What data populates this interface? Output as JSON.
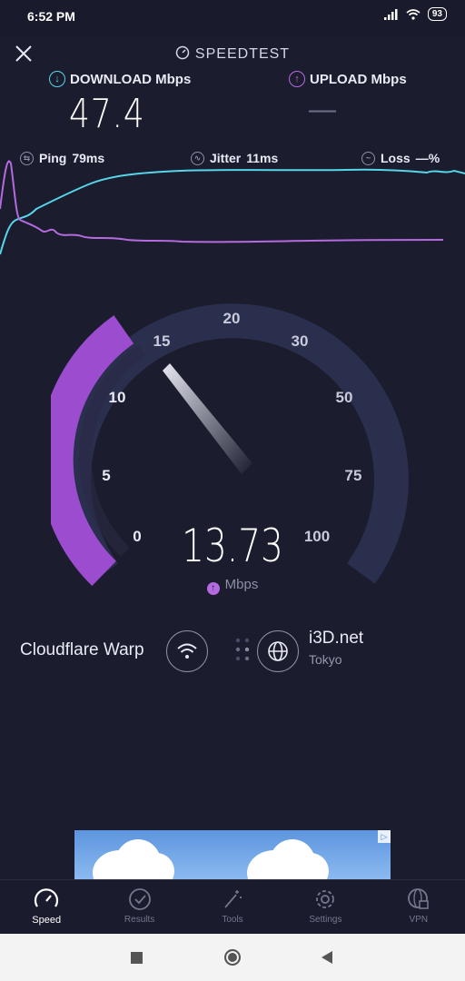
{
  "status_bar": {
    "time": "6:52 PM",
    "battery": "93"
  },
  "header": {
    "title": "SPEEDTEST"
  },
  "download": {
    "label": "DOWNLOAD Mbps",
    "value": "47.4"
  },
  "upload": {
    "label": "UPLOAD Mbps",
    "value": "—"
  },
  "stats": {
    "ping_label": "Ping",
    "ping_value": "79ms",
    "jitter_label": "Jitter",
    "jitter_value": "11ms",
    "loss_label": "Loss",
    "loss_value": "—%"
  },
  "gauge": {
    "ticks": [
      "0",
      "5",
      "10",
      "15",
      "20",
      "30",
      "50",
      "75",
      "100"
    ],
    "current_speed": "13.73",
    "unit": "Mbps",
    "fill_fraction": 0.31,
    "colors": {
      "fill": "#9b4ccf",
      "track": "#2a2f4e",
      "needle": "#e6e7f2"
    }
  },
  "connection": {
    "provider": "Cloudflare Warp",
    "server_name": "i3D.net",
    "server_city": "Tokyo"
  },
  "colors": {
    "download_line": "#56d6e8",
    "upload_line": "#b56ae0",
    "background": "#1b1c2e"
  },
  "nav": {
    "items": [
      {
        "label": "Speed",
        "icon": "speedometer-icon",
        "active": true
      },
      {
        "label": "Results",
        "icon": "check-circle-icon",
        "active": false
      },
      {
        "label": "Tools",
        "icon": "magic-wand-icon",
        "active": false
      },
      {
        "label": "Settings",
        "icon": "gear-icon",
        "active": false
      },
      {
        "label": "VPN",
        "icon": "globe-lock-icon",
        "active": false
      }
    ]
  }
}
